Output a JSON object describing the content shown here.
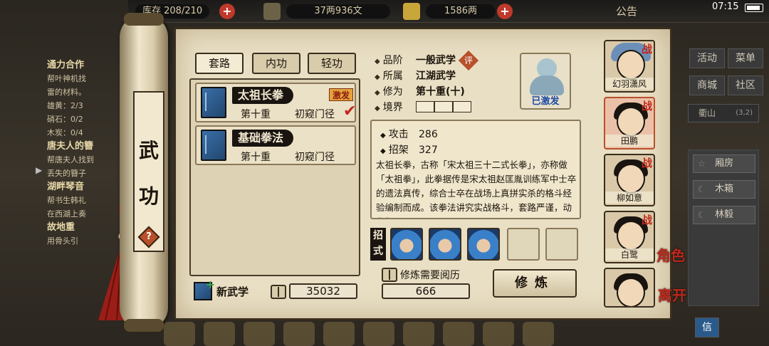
{
  "topbar": {
    "stock": "库存 208/210",
    "silver": "37两936文",
    "gold": "1586两",
    "announcement": "公告",
    "time": "07:15"
  },
  "quests": [
    {
      "title": "通力合作",
      "lines": [
        "帮叶神机找",
        "雷的材料。",
        "雄黄：2/3",
        "硝石：0/2",
        "木炭：0/4"
      ]
    },
    {
      "title": "唐夫人的簪",
      "lines": [
        "帮唐夫人找到",
        "丢失的簪子"
      ]
    },
    {
      "title": "湖畔琴音",
      "lines": [
        "帮书生韩礼",
        "在西湖上奏"
      ]
    },
    {
      "title": "故地重",
      "lines": [
        "用骨头引"
      ]
    }
  ],
  "right_panel": {
    "buttons": [
      "活动",
      "菜单",
      "商城",
      "社区"
    ],
    "location": "衢山",
    "location_coord": "(3,2)",
    "rooms": [
      "厢房",
      "木箱",
      "林毅"
    ],
    "bottom_badge": "信"
  },
  "scroll": {
    "title_chars": [
      "武",
      "功"
    ],
    "help_label": "?"
  },
  "tabs": [
    "套路",
    "内功",
    "轻功"
  ],
  "arts": [
    {
      "name": "太祖长拳",
      "level": "第十重",
      "stage": "初窥门径",
      "tag": "激发",
      "checked": true
    },
    {
      "name": "基础拳法",
      "level": "第十重",
      "stage": "初窥门径",
      "tag": "",
      "checked": false
    }
  ],
  "new_art_label": "新武学",
  "reading_points": "35032",
  "details": {
    "grade_label": "品阶",
    "grade_value": "一般武学",
    "grade_badge": "评",
    "school_label": "所属",
    "school_value": "江湖武学",
    "cultivation_label": "修为",
    "cultivation_value": "第十重(十)",
    "realm_label": "境界",
    "portrait_status": "已激发",
    "attack_label": "攻击",
    "attack_value": "286",
    "parry_label": "招架",
    "parry_value": "327",
    "description": "太祖长拳，古称「宋太祖三十二式长拳」，亦称做「太祖拳」，此拳据传是宋太祖赵匡胤训练军中士卒的遗法真传，综合士卒在战场上真拼实杀的格斗经验编制而成。该拳法讲究实战格斗，套路严谨，动作舒展。"
  },
  "moves_label": "招式",
  "requirement_label": "修炼需要阅历",
  "requirement_value": "666",
  "train_button": "修炼",
  "characters": [
    {
      "name": "幻羽潇风",
      "badge": "战"
    },
    {
      "name": "田鹏",
      "badge": "战"
    },
    {
      "name": "柳如意",
      "badge": "战"
    },
    {
      "name": "白鹭",
      "badge": "战"
    },
    {
      "name": "",
      "badge": ""
    }
  ],
  "character_banner_top": "角色",
  "character_banner_bottom": "离开"
}
